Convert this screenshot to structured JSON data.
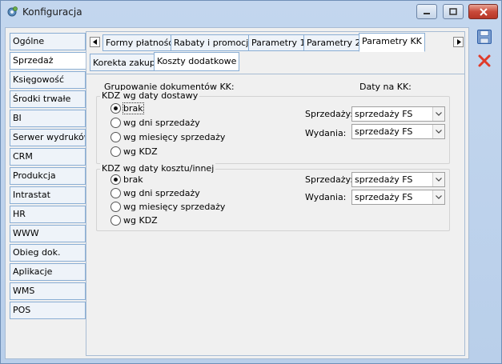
{
  "window": {
    "title": "Konfiguracja"
  },
  "sidebar": {
    "items": [
      {
        "label": "Ogólne"
      },
      {
        "label": "Sprzedaż",
        "active": true
      },
      {
        "label": "Księgowość"
      },
      {
        "label": "Środki trwałe"
      },
      {
        "label": "BI"
      },
      {
        "label": "Serwer wydruków"
      },
      {
        "label": "CRM"
      },
      {
        "label": "Produkcja"
      },
      {
        "label": "Intrastat"
      },
      {
        "label": "HR"
      },
      {
        "label": "WWW"
      },
      {
        "label": "Obieg dok."
      },
      {
        "label": "Aplikacje"
      },
      {
        "label": "WMS"
      },
      {
        "label": "POS"
      }
    ]
  },
  "tabs": [
    {
      "label": "Formy płatności"
    },
    {
      "label": "Rabaty i promocje"
    },
    {
      "label": "Parametry 1"
    },
    {
      "label": "Parametry 2"
    },
    {
      "label": "Parametry KK",
      "active": true
    }
  ],
  "subtabs": [
    {
      "label": "Korekta zakupu"
    },
    {
      "label": "Koszty dodatkowe",
      "active": true
    }
  ],
  "panel": {
    "grouping_label": "Grupowanie dokumentów KK:",
    "dates_label": "Daty na KK:",
    "group1": {
      "title": "KDZ wg daty dostawy",
      "options": [
        "brak",
        "wg dni sprzedaży",
        "wg miesięcy sprzedaży",
        "wg KDZ"
      ],
      "selected": "brak",
      "sales_label": "Sprzedaży:",
      "sales_value": "sprzedaży FS",
      "issues_label": "Wydania:",
      "issues_value": "sprzedaży FS"
    },
    "group2": {
      "title": "KDZ wg daty kosztu/innej",
      "options": [
        "brak",
        "wg dni sprzedaży",
        "wg miesięcy sprzedaży",
        "wg KDZ"
      ],
      "selected": "brak",
      "sales_label": "Sprzedaży:",
      "sales_value": "sprzedaży FS",
      "issues_label": "Wydania:",
      "issues_value": "sprzedaży FS"
    }
  },
  "colors": {
    "accent_border": "#8aaed4",
    "close_red": "#c94a3a",
    "save_blue": "#2f5fa8",
    "cancel_red": "#e03a2a"
  },
  "icons": [
    "gear-icon",
    "minimize-icon",
    "maximize-icon",
    "close-icon",
    "save-icon",
    "cancel-icon",
    "arrow-left-icon",
    "arrow-right-icon",
    "chevron-down-icon"
  ]
}
